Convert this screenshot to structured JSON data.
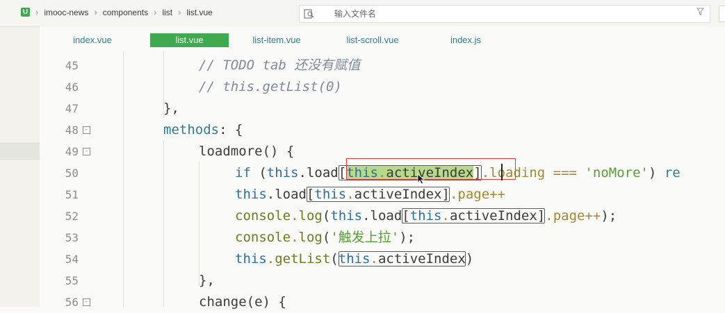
{
  "breadcrumbs": [
    "imooc-news",
    "components",
    "list",
    "list.vue"
  ],
  "search": {
    "placeholder": "输入文件名"
  },
  "tabs": [
    {
      "label": "index.vue",
      "active": false
    },
    {
      "label": "list.vue",
      "active": true
    },
    {
      "label": "list-item.vue",
      "active": false
    },
    {
      "label": "list-scroll.vue",
      "active": false
    },
    {
      "label": "index.js",
      "active": false
    }
  ],
  "lines": [
    {
      "num": "45",
      "fold": false
    },
    {
      "num": "46",
      "fold": false
    },
    {
      "num": "47",
      "fold": false
    },
    {
      "num": "48",
      "fold": true
    },
    {
      "num": "49",
      "fold": true
    },
    {
      "num": "50",
      "fold": false
    },
    {
      "num": "51",
      "fold": false
    },
    {
      "num": "52",
      "fold": false
    },
    {
      "num": "53",
      "fold": false
    },
    {
      "num": "54",
      "fold": false
    },
    {
      "num": "55",
      "fold": false
    },
    {
      "num": "56",
      "fold": true
    }
  ],
  "code": {
    "l45": "// TODO tab 还没有赋值",
    "l46": "// this.getList(0)",
    "l47": "},",
    "l48_a": "methods",
    "l48_b": ": {",
    "l49_a": "loadmore",
    "l49_b": "() {",
    "l50": [
      "if",
      " (",
      "this",
      ".load",
      "[",
      "this",
      ".",
      "activeIndex",
      "]",
      ".loading ",
      "===",
      " ",
      "'noMore'",
      ") ",
      "re"
    ],
    "l51": [
      "this",
      ".load",
      "[",
      "this",
      ".",
      "activeIndex",
      "]",
      ".page",
      "++"
    ],
    "l52": [
      "console",
      ".",
      "log",
      "(",
      "this",
      ".load",
      "[",
      "this",
      ".",
      "activeIndex",
      "]",
      ".page",
      "++",
      ");"
    ],
    "l53": [
      "console",
      ".",
      "log",
      "(",
      "'触发上拉'",
      ");"
    ],
    "l54": [
      "this",
      ".",
      "getList",
      "(",
      "this",
      ".",
      "activeIndex",
      ")"
    ],
    "l55": "},",
    "l56_a": "change",
    "l56_b": "(e) {"
  },
  "icons": {
    "project": "project-icon",
    "search": "file-search-icon",
    "filter": "filter-icon"
  },
  "colors": {
    "accent": "#3fa94e",
    "keyword": "#2f7d8b",
    "this": "#2e6da4",
    "method": "#6b7c1c",
    "string": "#56a033",
    "operator": "#a3892c",
    "selection": "#b7d98a",
    "highlight_box": "#e03b3b"
  }
}
